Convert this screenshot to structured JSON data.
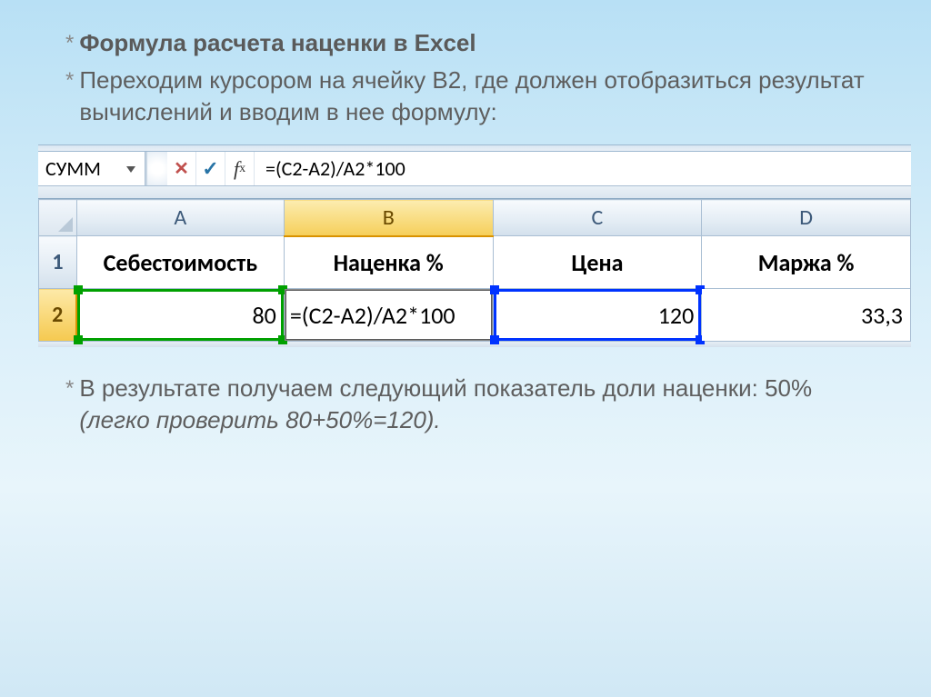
{
  "text": {
    "title": "Формула расчета наценки в Excel",
    "intro": "Переходим курсором на ячейку B2, где должен отобразиться результат вычислений и вводим в нее формулу:",
    "result_lead": "В результате получаем следующий показатель доли наценки: 50% ",
    "result_italic": "(легко проверить 80+50%=120)."
  },
  "excel": {
    "name_box": "СУММ",
    "formula": "=(C2-A2)/A2*100",
    "columns": [
      "A",
      "B",
      "C",
      "D"
    ],
    "row_numbers": [
      "1",
      "2"
    ],
    "headers": {
      "A": "Себестоимость",
      "B": "Наценка %",
      "C": "Цена",
      "D": "Маржа %"
    },
    "values": {
      "A2": "80",
      "B2": "=(C2-A2)/A2*100",
      "C2": "120",
      "D2": "33,3"
    },
    "icons": {
      "cancel": "✕",
      "enter": "✓"
    }
  }
}
